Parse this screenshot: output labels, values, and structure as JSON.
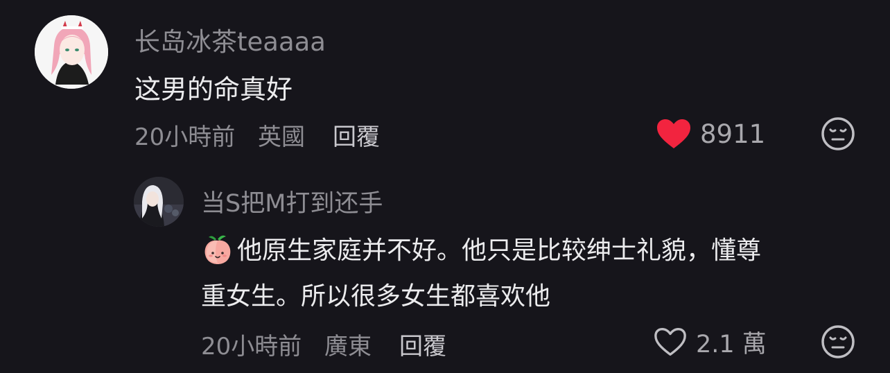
{
  "comments": [
    {
      "username": "长岛冰茶teaaaa",
      "text": "这男的命真好",
      "time": "20小時前",
      "location": "英國",
      "reply_label": "回覆",
      "like_count": "8911",
      "liked": true,
      "like_color": "#f2243f"
    },
    {
      "username": "当S把M打到还手",
      "text_line1": "他原生家庭并不好。他只是比较绅士礼貌，懂尊",
      "text_line2": "重女生。所以很多女生都喜欢他",
      "time": "20小時前",
      "location": "廣東",
      "reply_label": "回覆",
      "like_count": "2.1 萬",
      "liked": false
    }
  ]
}
